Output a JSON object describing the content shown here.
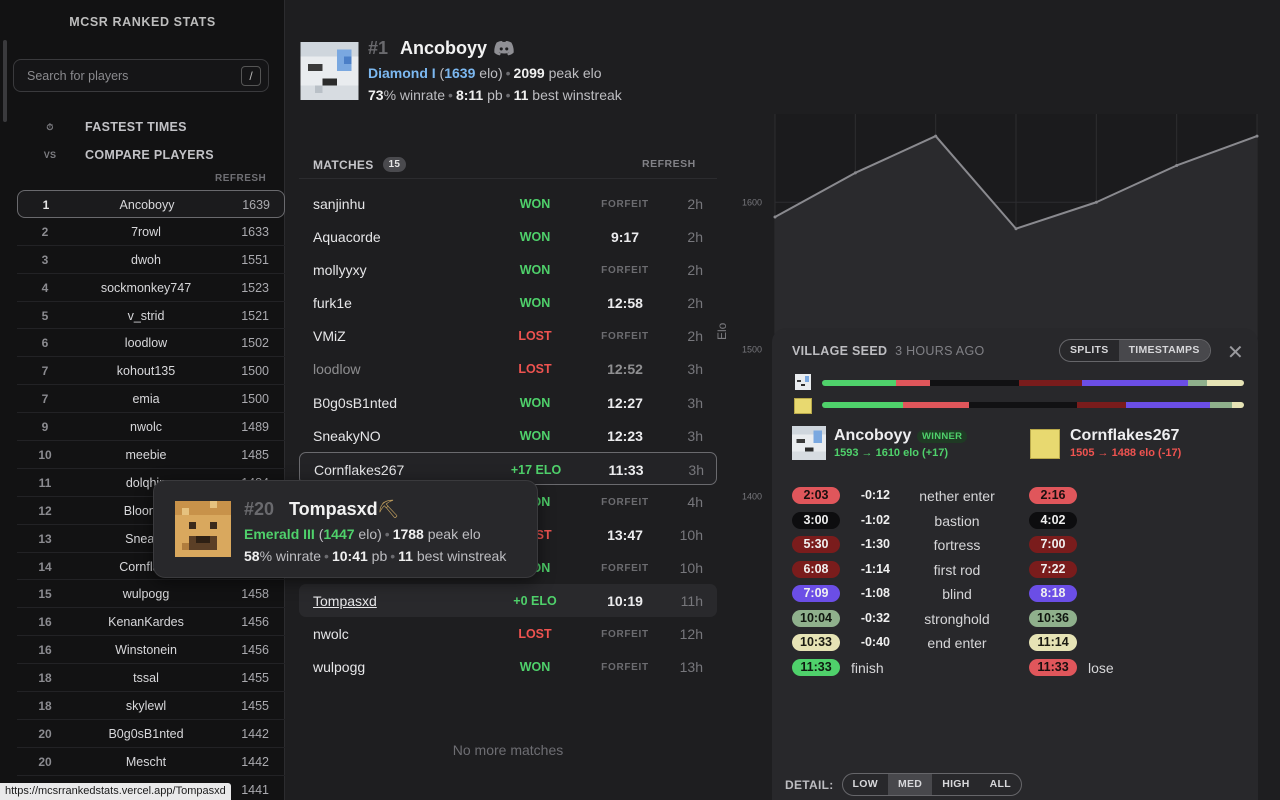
{
  "sidebar": {
    "title": "MCSR RANKED STATS",
    "search_placeholder": "Search for players",
    "search_shortcut": "/",
    "nav": [
      {
        "icon": "stopwatch-icon",
        "glyph": "⏱",
        "label": "FASTEST TIMES"
      },
      {
        "icon": "vs-icon",
        "glyph": "VS",
        "label": "COMPARE PLAYERS"
      }
    ],
    "refresh": "REFRESH",
    "leaderboard": [
      {
        "rank": "1",
        "name": "Ancoboyy",
        "elo": "1639"
      },
      {
        "rank": "2",
        "name": "7rowl",
        "elo": "1633"
      },
      {
        "rank": "3",
        "name": "dwoh",
        "elo": "1551"
      },
      {
        "rank": "4",
        "name": "sockmonkey747",
        "elo": "1523"
      },
      {
        "rank": "5",
        "name": "v_strid",
        "elo": "1521"
      },
      {
        "rank": "6",
        "name": "loodlow",
        "elo": "1502"
      },
      {
        "rank": "7",
        "name": "kohout135",
        "elo": "1500"
      },
      {
        "rank": "7",
        "name": "emia",
        "elo": "1500"
      },
      {
        "rank": "9",
        "name": "nwolc",
        "elo": "1489"
      },
      {
        "rank": "10",
        "name": "meebie",
        "elo": "1485"
      },
      {
        "rank": "11",
        "name": "dolqhin",
        "elo": "1484"
      },
      {
        "rank": "12",
        "name": "Bloonsk",
        "elo": ""
      },
      {
        "rank": "13",
        "name": "Sneaky",
        "elo": ""
      },
      {
        "rank": "14",
        "name": "Cornflake",
        "elo": ""
      },
      {
        "rank": "15",
        "name": "wulpogg",
        "elo": "1458"
      },
      {
        "rank": "16",
        "name": "KenanKardes",
        "elo": "1456"
      },
      {
        "rank": "16",
        "name": "Winstonein",
        "elo": "1456"
      },
      {
        "rank": "18",
        "name": "tssal",
        "elo": "1455"
      },
      {
        "rank": "18",
        "name": "skylewl",
        "elo": "1455"
      },
      {
        "rank": "20",
        "name": "B0g0sB1nted",
        "elo": "1442"
      },
      {
        "rank": "20",
        "name": "Mescht",
        "elo": "1442"
      },
      {
        "rank": "22",
        "name": "",
        "elo": "1441"
      }
    ],
    "status_url": "https://mcsrrankedstats.vercel.app/Tompasxd"
  },
  "player": {
    "rank": "#1",
    "name": "Ancoboyy",
    "tier": "Diamond I",
    "elo": "1639",
    "elo_unit": "elo",
    "peak_elo": "2099",
    "peak_label": "peak elo",
    "winrate": "73",
    "winrate_label": "% winrate",
    "pb": "8:11",
    "pb_label": "pb",
    "winstreak": "11",
    "winstreak_label": "best winstreak"
  },
  "matches": {
    "title": "MATCHES",
    "count": "15",
    "refresh": "REFRESH",
    "rows": [
      {
        "opponent": "sanjinhu",
        "result": "WON",
        "time": "FORFEIT",
        "ago": "2h"
      },
      {
        "opponent": "Aquacorde",
        "result": "WON",
        "time": "9:17",
        "ago": "2h"
      },
      {
        "opponent": "mollyyxy",
        "result": "WON",
        "time": "FORFEIT",
        "ago": "2h"
      },
      {
        "opponent": "furk1e",
        "result": "WON",
        "time": "12:58",
        "ago": "2h"
      },
      {
        "opponent": "VMiZ",
        "result": "LOST",
        "time": "FORFEIT",
        "ago": "2h"
      },
      {
        "opponent": "loodlow",
        "result": "LOST",
        "time": "12:52",
        "ago": "3h"
      },
      {
        "opponent": "B0g0sB1nted",
        "result": "WON",
        "time": "12:27",
        "ago": "3h"
      },
      {
        "opponent": "SneakyNO",
        "result": "WON",
        "time": "12:23",
        "ago": "3h"
      },
      {
        "opponent": "Cornflakes267",
        "result": "+17 ELO",
        "time": "11:33",
        "ago": "3h"
      },
      {
        "opponent": "",
        "result": "WON",
        "time": "FORFEIT",
        "ago": "4h"
      },
      {
        "opponent": "",
        "result": "LOST",
        "time": "13:47",
        "ago": "10h"
      },
      {
        "opponent": "",
        "result": "WON",
        "time": "FORFEIT",
        "ago": "10h"
      },
      {
        "opponent": "Tompasxd",
        "result": "+0 ELO",
        "time": "10:19",
        "ago": "11h"
      },
      {
        "opponent": "nwolc",
        "result": "LOST",
        "time": "FORFEIT",
        "ago": "12h"
      },
      {
        "opponent": "wulpogg",
        "result": "WON",
        "time": "FORFEIT",
        "ago": "13h"
      }
    ],
    "no_more": "No more matches"
  },
  "hover_card": {
    "rank": "#20",
    "name": "Tompasxd",
    "tier": "Emerald III",
    "elo": "1447",
    "elo_unit": "elo",
    "peak_elo": "1788",
    "peak_label": "peak elo",
    "winrate": "58",
    "winrate_label": "% winrate",
    "pb": "10:41",
    "pb_label": "pb",
    "winstreak": "11",
    "winstreak_label": "best winstreak"
  },
  "chart_data": {
    "type": "line",
    "x": [
      1,
      2,
      3,
      4,
      5,
      6,
      7
    ],
    "values": [
      1590,
      1620,
      1645,
      1582,
      1600,
      1625,
      1645
    ],
    "ylabel": "Elo",
    "yticks": [
      "1600",
      "1500",
      "1400"
    ],
    "ylim": [
      1350,
      1660
    ],
    "grid": true,
    "line_color": "#8a8a8f",
    "fill_color": "#2a2a2d"
  },
  "match_detail": {
    "seed": "VILLAGE SEED",
    "ago": "3 HOURS AGO",
    "toggle": [
      "SPLITS",
      "TIMESTAMPS"
    ],
    "toggle_active": "TIMESTAMPS",
    "player_a": {
      "name": "Ancoboyy",
      "badge": "WINNER",
      "elo": "1593 → 1610 elo (+17)"
    },
    "player_b": {
      "name": "Cornflakes267",
      "elo": "1505 → 1488 elo (-17)"
    },
    "bars": [
      {
        "segments": [
          {
            "frac": 0.175,
            "color": "#4fd16b"
          },
          {
            "frac": 0.082,
            "color": "#e0565b"
          },
          {
            "frac": 0.21,
            "color": "#111113"
          },
          {
            "frac": 0.15,
            "color": "#7a1c1c"
          },
          {
            "frac": 0.25,
            "color": "#6b4ee6"
          },
          {
            "frac": 0.045,
            "color": "#8fb08c"
          },
          {
            "frac": 0.088,
            "color": "#e6e3b5"
          }
        ]
      },
      {
        "segments": [
          {
            "frac": 0.193,
            "color": "#4fd16b"
          },
          {
            "frac": 0.155,
            "color": "#e0565b"
          },
          {
            "frac": 0.257,
            "color": "#111113"
          },
          {
            "frac": 0.115,
            "color": "#7a1c1c"
          },
          {
            "frac": 0.2,
            "color": "#6b4ee6"
          },
          {
            "frac": 0.052,
            "color": "#8fb08c"
          },
          {
            "frac": 0.028,
            "color": "#e6e3b5"
          }
        ]
      }
    ],
    "splits": [
      {
        "a": "2:03",
        "diff": "-0:12",
        "event": "nether enter",
        "b": "2:16",
        "bg": "#e0565b",
        "fg": "#1a0f0f"
      },
      {
        "a": "3:00",
        "diff": "-1:02",
        "event": "bastion",
        "b": "4:02",
        "bg": "#0d0d0f",
        "fg": "#f0f0f0"
      },
      {
        "a": "5:30",
        "diff": "-1:30",
        "event": "fortress",
        "b": "7:00",
        "bg": "#7a1c1c",
        "fg": "#f0f0f0"
      },
      {
        "a": "6:08",
        "diff": "-1:14",
        "event": "first rod",
        "b": "7:22",
        "bg": "#7a1c1c",
        "fg": "#f0f0f0"
      },
      {
        "a": "7:09",
        "diff": "-1:08",
        "event": "blind",
        "b": "8:18",
        "bg": "#6b4ee6",
        "fg": "#f0f0f0"
      },
      {
        "a": "10:04",
        "diff": "-0:32",
        "event": "stronghold",
        "b": "10:36",
        "bg": "#8fb08c",
        "fg": "#10160f"
      },
      {
        "a": "10:33",
        "diff": "-0:40",
        "event": "end enter",
        "b": "11:14",
        "bg": "#e6e3b5",
        "fg": "#1a1a12"
      }
    ],
    "finish": {
      "a": "11:33",
      "a_label": "finish",
      "b": "11:33",
      "b_label": "lose"
    },
    "detail_label": "DETAIL:",
    "detail_levels": [
      "LOW",
      "MED",
      "HIGH",
      "ALL"
    ],
    "detail_active": "MED"
  }
}
